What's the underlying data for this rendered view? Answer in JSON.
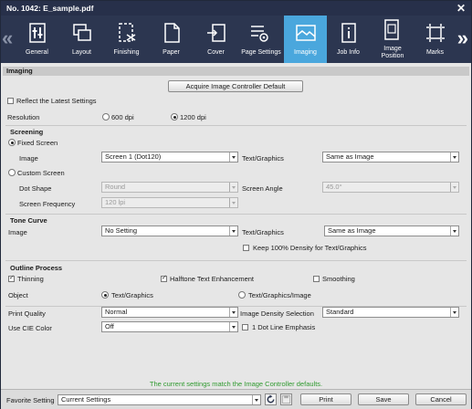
{
  "window": {
    "title": "No. 1042: E_sample.pdf",
    "close_glyph": "✕"
  },
  "toolbar": {
    "prev_glyph": "«",
    "next_glyph": "»",
    "items": [
      {
        "label": "General",
        "icon": "general-icon"
      },
      {
        "label": "Layout",
        "icon": "layout-icon"
      },
      {
        "label": "Finishing",
        "icon": "finishing-icon"
      },
      {
        "label": "Paper",
        "icon": "paper-icon"
      },
      {
        "label": "Cover",
        "icon": "cover-icon"
      },
      {
        "label": "Page Settings",
        "icon": "page-settings-icon"
      },
      {
        "label": "Imaging",
        "icon": "imaging-icon",
        "active": true
      },
      {
        "label": "Job Info",
        "icon": "job-info-icon"
      },
      {
        "label": "Image Position",
        "icon": "image-position-icon"
      },
      {
        "label": "Marks",
        "icon": "marks-icon"
      }
    ]
  },
  "imaging": {
    "header": "Imaging",
    "acquire_button": "Acquire Image Controller Default",
    "reflect_latest": {
      "label": "Reflect the Latest Settings",
      "checked": false
    },
    "resolution": {
      "label": "Resolution",
      "options": [
        "600 dpi",
        "1200 dpi"
      ],
      "selected": "1200 dpi"
    }
  },
  "screening": {
    "title": "Screening",
    "fixed_screen": {
      "label": "Fixed Screen",
      "selected": true
    },
    "image_label": "Image",
    "image_value": "Screen 1 (Dot120)",
    "text_graphics_label": "Text/Graphics",
    "text_graphics_value": "Same as Image",
    "custom_screen": {
      "label": "Custom Screen",
      "selected": false
    },
    "dot_shape_label": "Dot Shape",
    "dot_shape_value": "Round",
    "screen_angle_label": "Screen Angle",
    "screen_angle_value": "45.0°",
    "screen_frequency_label": "Screen Frequency",
    "screen_frequency_value": "120 lpi"
  },
  "tone_curve": {
    "title": "Tone Curve",
    "image_label": "Image",
    "image_value": "No Setting",
    "text_graphics_label": "Text/Graphics",
    "text_graphics_value": "Same as Image",
    "keep_density": {
      "label": "Keep 100% Density for Text/Graphics",
      "checked": false
    }
  },
  "outline": {
    "title": "Outline Process",
    "thinning": {
      "label": "Thinning",
      "checked": true
    },
    "halftone": {
      "label": "Halftone Text Enhancement",
      "checked": true
    },
    "smoothing": {
      "label": "Smoothing",
      "checked": false
    },
    "object_label": "Object",
    "object_options": [
      "Text/Graphics",
      "Text/Graphics/Image"
    ],
    "object_selected": "Text/Graphics"
  },
  "misc": {
    "print_quality_label": "Print Quality",
    "print_quality_value": "Normal",
    "density_label": "Image Density Selection",
    "density_value": "Standard",
    "cie_label": "Use CIE Color",
    "cie_value": "Off",
    "one_dot": {
      "label": "1 Dot Line Emphasis",
      "checked": false
    }
  },
  "status_message": "The current settings match the Image Controller defaults.",
  "footer": {
    "favorite_label": "Favorite Setting",
    "favorite_value": "Current Settings",
    "print_label": "Print",
    "save_label": "Save",
    "cancel_label": "Cancel"
  },
  "colors": {
    "toolbar_bg": "#2c3650",
    "title_bg": "#27304a",
    "active_tab": "#4aa7dd",
    "status_text": "#2f9a2f"
  }
}
